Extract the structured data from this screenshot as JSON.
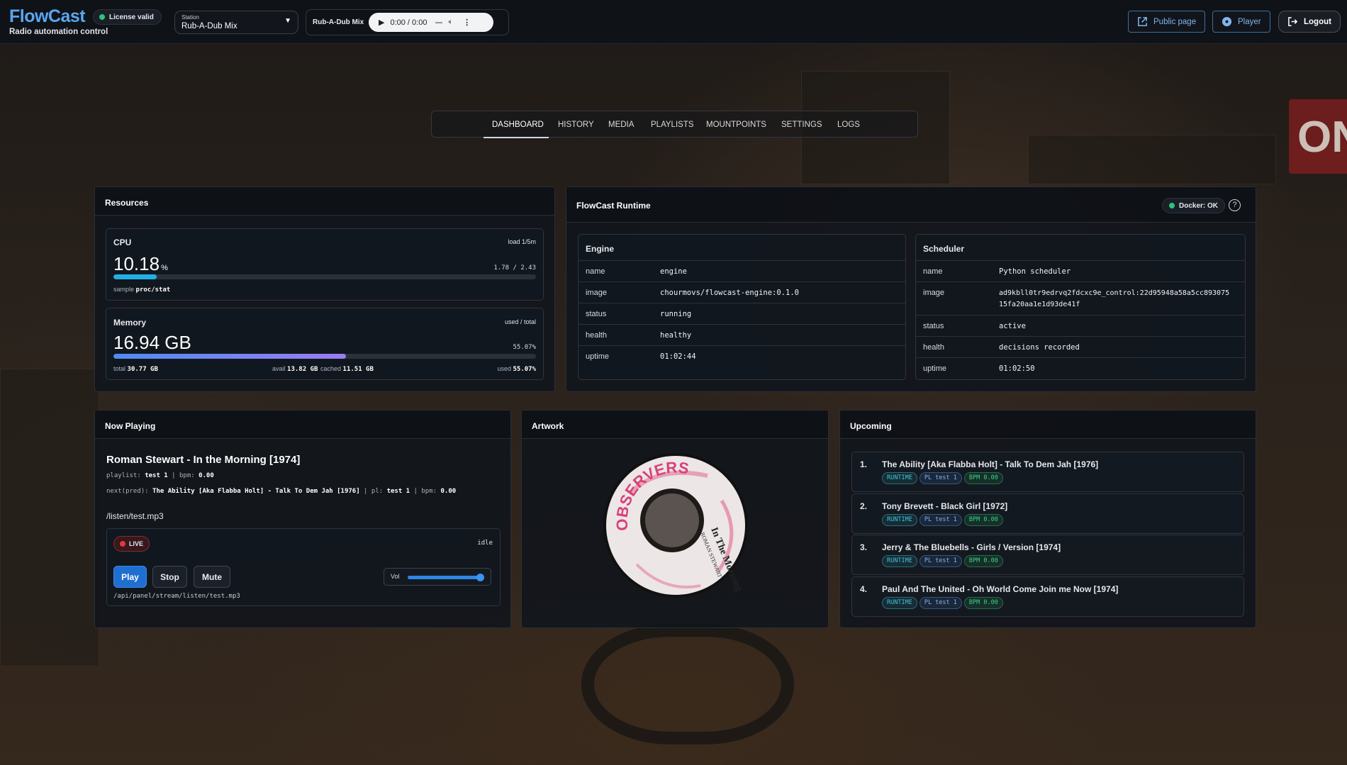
{
  "brand": {
    "name": "FlowCast",
    "subtitle": "Radio automation control"
  },
  "license": {
    "label": "License valid"
  },
  "station": {
    "label": "Station",
    "value": "Rub-A-Dub Mix"
  },
  "player": {
    "label": "Rub-A-Dub Mix",
    "time": "0:00 / 0:00"
  },
  "header_buttons": {
    "public_page": "Public page",
    "player": "Player",
    "logout": "Logout"
  },
  "tabs": [
    "DASHBOARD",
    "HISTORY",
    "MEDIA",
    "PLAYLISTS",
    "MOUNTPOINTS",
    "SETTINGS",
    "LOGS"
  ],
  "resources": {
    "title": "Resources",
    "cpu": {
      "label": "CPU",
      "load_label": "load 1/5m",
      "value": "10.18",
      "unit": "%",
      "load": "1.78 / 2.43",
      "sample_label": "sample",
      "sample": "proc/stat",
      "percent": 10.18
    },
    "memory": {
      "label": "Memory",
      "right_label": "used / total",
      "value": "16.94 GB",
      "pct": "55.07%",
      "percent": 55.07,
      "total_label": "total",
      "total": "30.77 GB",
      "avail_label": "avail",
      "avail": "13.82 GB",
      "cached_label": "cached",
      "cached": "11.51 GB",
      "used_label": "used",
      "used": "55.07%"
    }
  },
  "runtime": {
    "title": "FlowCast Runtime",
    "docker": "Docker: OK",
    "engine": {
      "title": "Engine",
      "rows": [
        [
          "name",
          "engine"
        ],
        [
          "image",
          "chourmovs/flowcast-engine:0.1.0"
        ],
        [
          "status",
          "running"
        ],
        [
          "health",
          "healthy"
        ],
        [
          "uptime",
          "01:02:44"
        ]
      ]
    },
    "scheduler": {
      "title": "Scheduler",
      "rows": [
        [
          "name",
          "Python scheduler"
        ],
        [
          "image",
          "ad9kbll0tr9edrvq2fdcxc9e_control:22d95948a58a5cc893075\n15fa20aa1e1d93de41f"
        ],
        [
          "status",
          "active"
        ],
        [
          "health",
          "decisions recorded"
        ],
        [
          "uptime",
          "01:02:50"
        ]
      ]
    }
  },
  "now_playing": {
    "title": "Now Playing",
    "track": "Roman Stewart - In the Morning [1974]",
    "meta_playlist_label": "playlist:",
    "meta_playlist": "test 1",
    "meta_bpm_label": "bpm:",
    "meta_bpm": "0.00",
    "next_label": "next(pred):",
    "next_track": "The Ability [Aka Flabba Holt] - Talk To Dem Jah [1976]",
    "next_pl_label": "pl:",
    "next_pl": "test 1",
    "next_bpm_label": "bpm:",
    "next_bpm": "0.00",
    "path": "/listen/test.mp3",
    "live": "LIVE",
    "state": "idle",
    "play": "Play",
    "stop": "Stop",
    "mute": "Mute",
    "vol_label": "Vol",
    "volume": 0.95,
    "stream_url": "/api/panel/stream/listen/test.mp3"
  },
  "artwork": {
    "title": "Artwork",
    "label_top": "OBSERVERS",
    "label_song": "In The Morning",
    "label_artist": "ROMAN STEWART"
  },
  "upcoming": {
    "title": "Upcoming",
    "items": [
      {
        "n": "1.",
        "title": "The Ability [Aka Flabba Holt] - Talk To Dem Jah [1976]",
        "rt": "RUNTIME",
        "pl": "PL test 1",
        "bpm": "BPM 0.00"
      },
      {
        "n": "2.",
        "title": "Tony Brevett  - Black Girl [1972]",
        "rt": "RUNTIME",
        "pl": "PL test 1",
        "bpm": "BPM 0.00"
      },
      {
        "n": "3.",
        "title": "Jerry & The Bluebells  - Girls / Version [1974]",
        "rt": "RUNTIME",
        "pl": "PL test 1",
        "bpm": "BPM 0.00"
      },
      {
        "n": "4.",
        "title": "Paul And The United - Oh World Come Join me Now [1974]",
        "rt": "RUNTIME",
        "pl": "PL test 1",
        "bpm": "BPM 0.00"
      }
    ]
  },
  "colors": {
    "accent": "#5aa6f0",
    "primary_button": "#1f6fd1",
    "ok": "#2ec27e",
    "live": "#e53935"
  }
}
